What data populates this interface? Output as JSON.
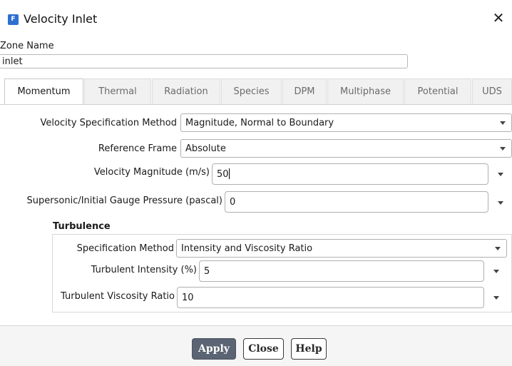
{
  "window": {
    "title": "Velocity Inlet",
    "app_icon": "F",
    "close_glyph": "✕"
  },
  "zone": {
    "label": "Zone Name",
    "value": "inlet"
  },
  "tabs": [
    {
      "label": "Momentum",
      "active": true
    },
    {
      "label": "Thermal"
    },
    {
      "label": "Radiation"
    },
    {
      "label": "Species"
    },
    {
      "label": "DPM"
    },
    {
      "label": "Multiphase"
    },
    {
      "label": "Potential"
    },
    {
      "label": "UDS"
    }
  ],
  "momentum": {
    "vel_method_label": "Velocity Specification Method",
    "vel_method_value": "Magnitude, Normal to Boundary",
    "ref_frame_label": "Reference Frame",
    "ref_frame_value": "Absolute",
    "vel_mag_label": "Velocity Magnitude (m/s)",
    "vel_mag_value": "50",
    "pressure_label": "Supersonic/Initial Gauge Pressure (pascal)",
    "pressure_value": "0"
  },
  "turbulence": {
    "heading": "Turbulence",
    "spec_label": "Specification Method",
    "spec_value": "Intensity and Viscosity Ratio",
    "intensity_label": "Turbulent Intensity (%)",
    "intensity_value": "5",
    "visc_label": "Turbulent Viscosity Ratio",
    "visc_value": "10"
  },
  "buttons": {
    "apply": "Apply",
    "close": "Close",
    "help": "Help"
  },
  "colors": {
    "apply_bg": "#5b6472",
    "app_icon_bg": "#2f6fd1"
  }
}
